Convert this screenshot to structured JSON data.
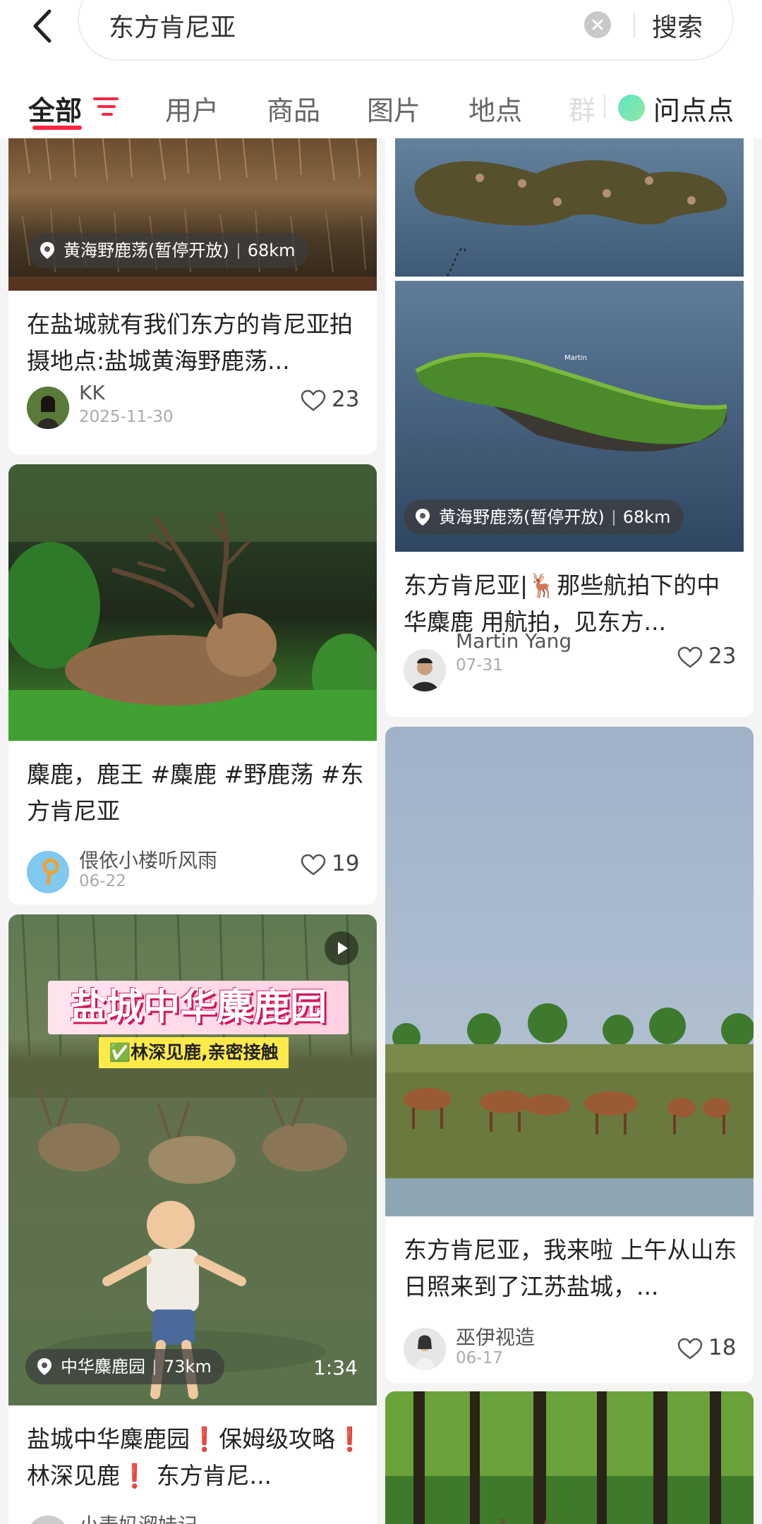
{
  "search": {
    "query": "东方肯尼亚",
    "submit_label": "搜索"
  },
  "tabs": [
    {
      "label": "全部"
    },
    {
      "label": "用户"
    },
    {
      "label": "商品"
    },
    {
      "label": "图片"
    },
    {
      "label": "地点"
    },
    {
      "label": "群"
    }
  ],
  "ask": {
    "label": "问点点"
  },
  "cards": [
    {
      "location": "黄海野鹿荡(暂停开放)",
      "distance": "68km",
      "title": "在盐城就有我们东方的肯尼亚拍摄地点:盐城黄海野鹿荡...",
      "author": "KK",
      "date": "2025-11-30",
      "likes": "23"
    },
    {
      "title": "麋鹿，鹿王 #麋鹿 #野鹿荡 #东方肯尼亚",
      "author": "偎依小楼听风雨",
      "date": "06-22",
      "likes": "19"
    },
    {
      "overlay_title": "盐城中华麋鹿园",
      "overlay_tag": "✅林深见鹿,亲密接触",
      "location": "中华麋鹿园",
      "distance": "73km",
      "duration": "1:34",
      "title": "盐城中华麋鹿园❗保姆级攻略❗林深见鹿❗ 东方肯尼...",
      "author": "小麦妈溜娃记"
    },
    {
      "image_watermark": "Martin",
      "location": "黄海野鹿荡(暂停开放)",
      "distance": "68km",
      "title": "东方肯尼亚|🦌那些航拍下的中华麋鹿 用航拍，见东方...",
      "author": "Martin Yang",
      "date": "07-31",
      "likes": "23"
    },
    {
      "title": "东方肯尼亚，我来啦 上午从山东日照来到了江苏盐城，...",
      "author": "巫伊视造",
      "date": "06-17",
      "likes": "18"
    }
  ],
  "colors": {
    "accent": "#ff2442",
    "card_bg": "#ffffff",
    "page_bg": "#f4f4f4"
  },
  "icons": [
    "back-arrow-icon",
    "clear-icon",
    "filter-icon",
    "location-pin-icon",
    "heart-icon",
    "play-icon"
  ]
}
